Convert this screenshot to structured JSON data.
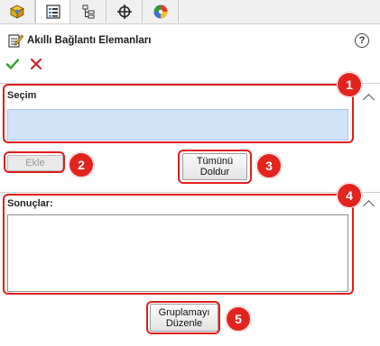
{
  "panel": {
    "title": "Akıllı Bağlantı Elemanları",
    "help_label": "?",
    "tabs": [
      {
        "name": "tab-feature-manager",
        "icon": "feature-manager-icon"
      },
      {
        "name": "tab-property-manager",
        "icon": "property-manager-icon"
      },
      {
        "name": "tab-configuration-manager",
        "icon": "configuration-manager-icon"
      },
      {
        "name": "tab-dimxpert-manager",
        "icon": "crosshair-icon"
      },
      {
        "name": "tab-display-manager",
        "icon": "appearance-icon"
      }
    ],
    "ok_icon": "checkmark-icon",
    "cancel_icon": "close-icon"
  },
  "selection": {
    "label": "Seçim",
    "add_button": "Ekle",
    "fill_all_button": [
      "Tümünü",
      "Doldur"
    ]
  },
  "results": {
    "label": "Sonuçlar:",
    "edit_grouping_button": [
      "Gruplamayı",
      "Düzenle"
    ]
  },
  "callouts": [
    "1",
    "2",
    "3",
    "4",
    "5"
  ],
  "colors": {
    "callout": "#e3241e",
    "selection_box": "#cfe4f8",
    "ok": "#2e9e2e",
    "cancel": "#d42020"
  }
}
